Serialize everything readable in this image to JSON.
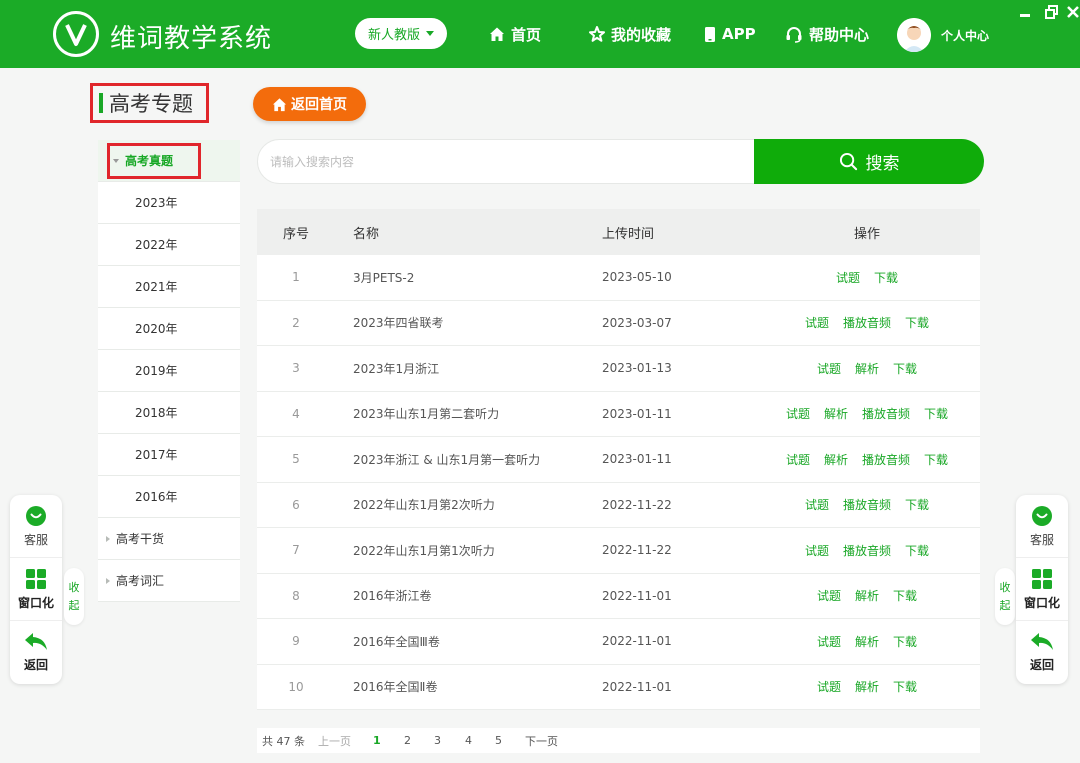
{
  "header": {
    "app_title": "维词教学系统",
    "version_select": "新人教版",
    "nav": [
      {
        "label": "首页",
        "icon": "home-icon"
      },
      {
        "label": "我的收藏",
        "icon": "star-icon"
      },
      {
        "label": "APP",
        "icon": "phone-icon"
      },
      {
        "label": "帮助中心",
        "icon": "headset-icon"
      }
    ],
    "user_center": "个人中心",
    "accent": "#1bab27"
  },
  "sidebar": {
    "section_title": "高考专题",
    "active_group": "高考真题",
    "years": [
      "2023年",
      "2022年",
      "2021年",
      "2020年",
      "2019年",
      "2018年",
      "2017年",
      "2016年"
    ],
    "groups": [
      "高考干货",
      "高考词汇"
    ]
  },
  "main": {
    "back_home": "返回首页",
    "search_placeholder": "请输入搜索内容",
    "search_button": "搜索",
    "columns": [
      "序号",
      "名称",
      "上传时间",
      "操作"
    ],
    "rows": [
      {
        "no": "1",
        "name": "3月PETS-2",
        "time": "2023-05-10",
        "ops": [
          "试题",
          "下载"
        ]
      },
      {
        "no": "2",
        "name": "2023年四省联考",
        "time": "2023-03-07",
        "ops": [
          "试题",
          "播放音频",
          "下载"
        ]
      },
      {
        "no": "3",
        "name": "2023年1月浙江",
        "time": "2023-01-13",
        "ops": [
          "试题",
          "解析",
          "下载"
        ]
      },
      {
        "no": "4",
        "name": "2023年山东1月第二套听力",
        "time": "2023-01-11",
        "ops": [
          "试题",
          "解析",
          "播放音频",
          "下载"
        ]
      },
      {
        "no": "5",
        "name": "2023年浙江 & 山东1月第一套听力",
        "time": "2023-01-11",
        "ops": [
          "试题",
          "解析",
          "播放音频",
          "下载"
        ]
      },
      {
        "no": "6",
        "name": "2022年山东1月第2次听力",
        "time": "2022-11-22",
        "ops": [
          "试题",
          "播放音频",
          "下载"
        ]
      },
      {
        "no": "7",
        "name": "2022年山东1月第1次听力",
        "time": "2022-11-22",
        "ops": [
          "试题",
          "播放音频",
          "下载"
        ]
      },
      {
        "no": "8",
        "name": "2016年浙江卷",
        "time": "2022-11-01",
        "ops": [
          "试题",
          "解析",
          "下载"
        ]
      },
      {
        "no": "9",
        "name": "2016年全国Ⅲ卷",
        "time": "2022-11-01",
        "ops": [
          "试题",
          "解析",
          "下载"
        ]
      },
      {
        "no": "10",
        "name": "2016年全国Ⅱ卷",
        "time": "2022-11-01",
        "ops": [
          "试题",
          "解析",
          "下载"
        ]
      }
    ],
    "pager": {
      "total": "共 47 条",
      "prev": "上一页",
      "pages": [
        "1",
        "2",
        "3",
        "4",
        "5"
      ],
      "current": "1",
      "next": "下一页"
    }
  },
  "float_panel": {
    "service": "客服",
    "windowed": "窗口化",
    "back": "返回",
    "collapse": [
      "收",
      "起"
    ]
  }
}
